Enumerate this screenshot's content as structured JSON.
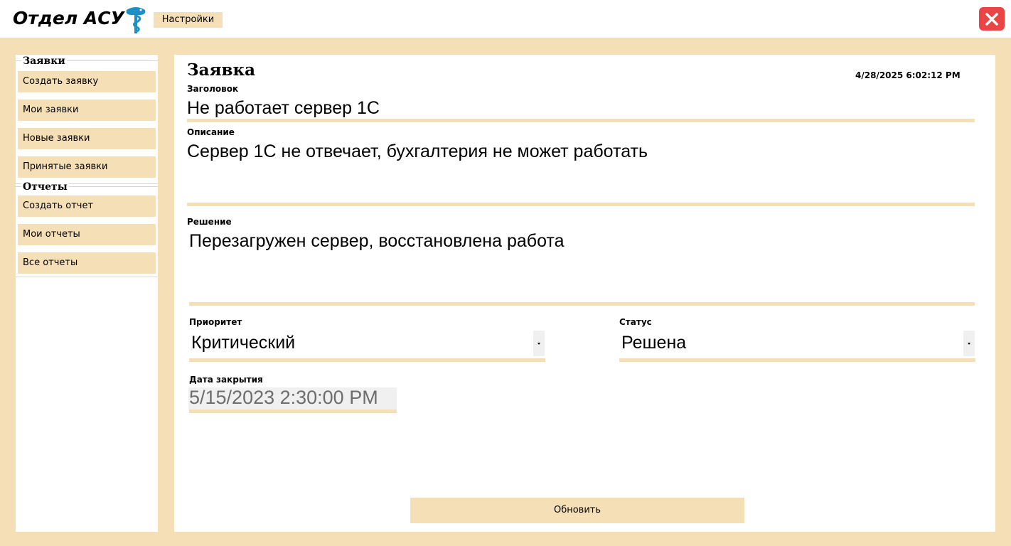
{
  "header": {
    "app_title": "Отдел АСУ",
    "settings_label": "Настройки",
    "close_icon": "close-icon",
    "logo_icon": "caduceus-icon",
    "accent_color": "#f5dfb6",
    "close_color": "#ea4444"
  },
  "sidebar": {
    "groups": [
      {
        "title": "Заявки",
        "items": [
          {
            "label": "Создать заявку"
          },
          {
            "label": "Мои заявки"
          },
          {
            "label": "Новые заявки"
          },
          {
            "label": "Принятые заявки"
          }
        ]
      },
      {
        "title": "Отчеты",
        "items": [
          {
            "label": "Создать отчет"
          },
          {
            "label": "Мои отчеты"
          },
          {
            "label": "Все отчеты"
          }
        ]
      }
    ]
  },
  "main": {
    "title": "Заявка",
    "timestamp": "4/28/2025 6:02:12 PM",
    "heading_label": "Заголовок",
    "heading_value": "Не работает сервер 1С",
    "description_label": "Описание",
    "description_value": "Сервер 1С не отвечает, бухгалтерия не может работать",
    "solution_label": "Решение",
    "solution_value": "Перезагружен сервер, восстановлена работа",
    "priority_label": "Приоритет",
    "priority_value": "Критический",
    "status_label": "Статус",
    "status_value": "Решена",
    "close_date_label": "Дата закрытия",
    "close_date_value": "5/15/2023 2:30:00 PM",
    "update_label": "Обновить"
  }
}
